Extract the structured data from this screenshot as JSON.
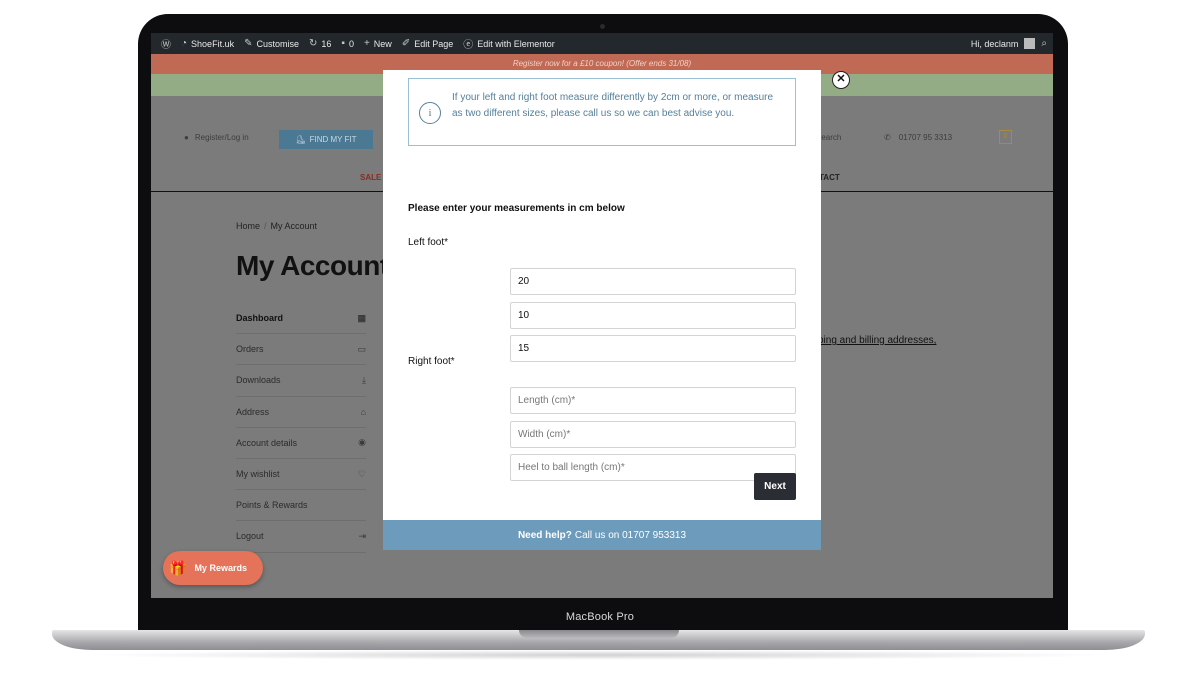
{
  "device": {
    "label": "MacBook Pro"
  },
  "admin_bar": {
    "site": "ShoeFit.uk",
    "customise": "Customise",
    "updates": "16",
    "comments": "0",
    "new": "New",
    "edit_page": "Edit Page",
    "edit_elementor": "Edit with Elementor",
    "greeting": "Hi, declanm"
  },
  "site": {
    "promo": "Register now for a £10 coupon! (Offer ends 31/08)",
    "register_login": "Register/Log in",
    "find_my_fit": "FIND MY FIT",
    "search": "Search",
    "phone": "01707 95 3313",
    "cart_count": "0",
    "nav_sale": "SALE",
    "nav_contact": "TACT"
  },
  "account": {
    "breadcrumb_home": "Home",
    "breadcrumb_sep": "/",
    "breadcrumb_current": "My Account",
    "title": "My Account",
    "menu": [
      {
        "label": "Dashboard",
        "icon": "▦"
      },
      {
        "label": "Orders",
        "icon": "▭"
      },
      {
        "label": "Downloads",
        "icon": "⤓"
      },
      {
        "label": "Address",
        "icon": "⌂"
      },
      {
        "label": "Account details",
        "icon": "◉"
      },
      {
        "label": "My wishlist",
        "icon": "♡"
      },
      {
        "label": "Points & Rewards",
        "icon": ""
      },
      {
        "label": "Logout",
        "icon": "⇥"
      }
    ],
    "dashboard_link": "ping and billing addresses,"
  },
  "rewards": {
    "label": "My Rewards"
  },
  "modal": {
    "close": "✕",
    "info_text": "If your left and right foot measure differently by 2cm or more, or measure as two different sizes, please call us so we can best advise you.",
    "instruction": "Please enter your measurements in cm below",
    "left_label": "Left foot*",
    "right_label": "Right foot*",
    "left_values": [
      "20",
      "10",
      "15"
    ],
    "right_placeholders": [
      "Length (cm)*",
      "Width (cm)*",
      "Heel to ball length (cm)*"
    ],
    "next": "Next",
    "help_bold": "Need help?",
    "help_text": "Call us on 01707 953313"
  },
  "colors": {
    "accent_blue": "#56809b",
    "help_bar": "#6d9bbb",
    "rewards": "#e4735a",
    "button_dark": "#2a2d33"
  }
}
